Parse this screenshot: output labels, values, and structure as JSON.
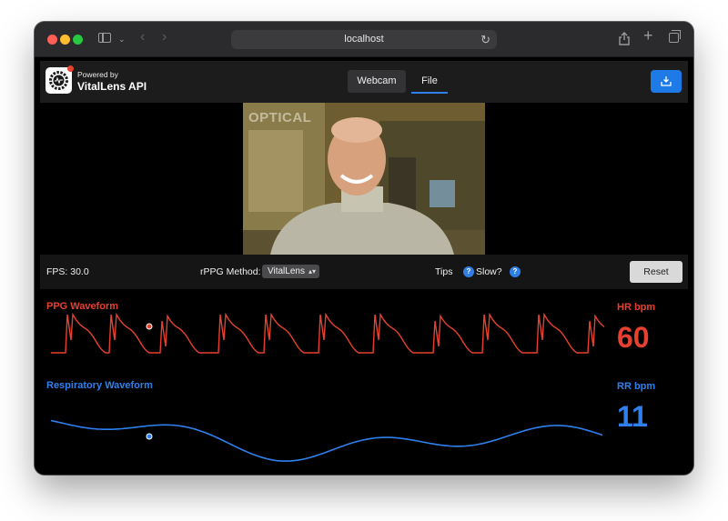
{
  "browser": {
    "url": "localhost"
  },
  "header": {
    "powered_by": "Powered by",
    "brand": "VitalLens API",
    "tabs": [
      {
        "label": "Webcam",
        "active": false
      },
      {
        "label": "File",
        "active": true
      }
    ],
    "download_icon": "download-icon"
  },
  "video": {
    "overlay_text": "OPTICAL"
  },
  "controls": {
    "fps": "FPS: 30.0",
    "method_label": "rPPG Method:",
    "method_value": "VitalLens",
    "tips": "Tips",
    "slow": "Slow?",
    "help_glyph": "?",
    "reset": "Reset"
  },
  "vitals": {
    "ppg_title": "PPG Waveform",
    "resp_title": "Respiratory Waveform",
    "hr_label": "HR bpm",
    "hr_value": "60",
    "rr_label": "RR bpm",
    "rr_value": "11"
  },
  "colors": {
    "ppg": "#e8402e",
    "resp": "#2f80ed",
    "accent": "#1e7ae6"
  }
}
